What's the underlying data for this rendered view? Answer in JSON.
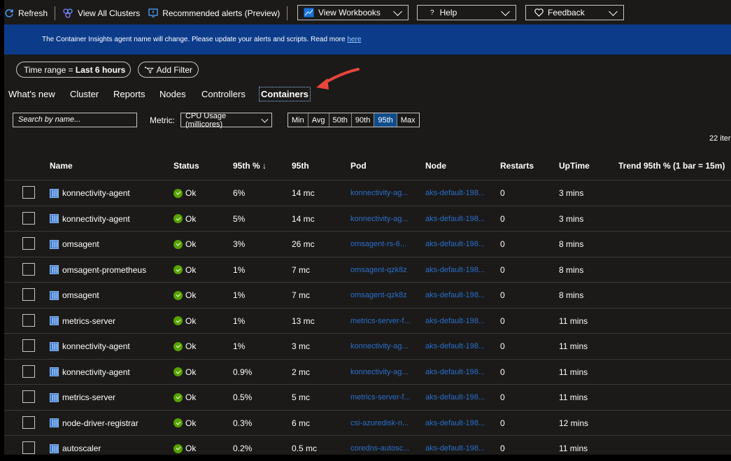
{
  "toolbar": {
    "refresh": "Refresh",
    "view_all_clusters": "View All Clusters",
    "recommended_alerts": "Recommended alerts (Preview)",
    "view_workbooks": "View Workbooks",
    "help": "Help",
    "feedback": "Feedback"
  },
  "banner": {
    "text": "The Container Insights agent name will change. Please update your alerts and scripts. Read more ",
    "link": "here"
  },
  "filters": {
    "time_range_prefix": "Time range = ",
    "time_range_value": "Last 6 hours",
    "add_filter": "Add Filter"
  },
  "tabs": [
    "What's new",
    "Cluster",
    "Reports",
    "Nodes",
    "Controllers",
    "Containers"
  ],
  "active_tab": "Containers",
  "search": {
    "placeholder": "Search by name..."
  },
  "metric": {
    "label": "Metric:",
    "value": "CPU Usage (millicores)"
  },
  "percentiles": [
    "Min",
    "Avg",
    "50th",
    "90th",
    "95th",
    "Max"
  ],
  "selected_percentile": "95th",
  "item_count": "22 iter",
  "table": {
    "headers": [
      "Name",
      "Status",
      "95th % ↓",
      "95th",
      "Pod",
      "Node",
      "Restarts",
      "UpTime",
      "Trend 95th % (1 bar = 15m)"
    ],
    "rows": [
      {
        "name": "konnectivity-agent",
        "status": "Ok",
        "pct": "6%",
        "val": "14 mc",
        "pod": "konnectivity-ag...",
        "node": "aks-default-198...",
        "restarts": "0",
        "uptime": "3 mins"
      },
      {
        "name": "konnectivity-agent",
        "status": "Ok",
        "pct": "5%",
        "val": "14 mc",
        "pod": "konnectivity-ag...",
        "node": "aks-default-198...",
        "restarts": "0",
        "uptime": "3 mins"
      },
      {
        "name": "omsagent",
        "status": "Ok",
        "pct": "3%",
        "val": "26 mc",
        "pod": "omsagent-rs-6...",
        "node": "aks-default-198...",
        "restarts": "0",
        "uptime": "8 mins"
      },
      {
        "name": "omsagent-prometheus",
        "status": "Ok",
        "pct": "1%",
        "val": "7 mc",
        "pod": "omsagent-qzk8z",
        "node": "aks-default-198...",
        "restarts": "0",
        "uptime": "8 mins"
      },
      {
        "name": "omsagent",
        "status": "Ok",
        "pct": "1%",
        "val": "7 mc",
        "pod": "omsagent-qzk8z",
        "node": "aks-default-198...",
        "restarts": "0",
        "uptime": "8 mins"
      },
      {
        "name": "metrics-server",
        "status": "Ok",
        "pct": "1%",
        "val": "13 mc",
        "pod": "metrics-server-f...",
        "node": "aks-default-198...",
        "restarts": "0",
        "uptime": "11 mins"
      },
      {
        "name": "konnectivity-agent",
        "status": "Ok",
        "pct": "1%",
        "val": "3 mc",
        "pod": "konnectivity-ag...",
        "node": "aks-default-198...",
        "restarts": "0",
        "uptime": "11 mins"
      },
      {
        "name": "konnectivity-agent",
        "status": "Ok",
        "pct": "0.9%",
        "val": "2 mc",
        "pod": "konnectivity-ag...",
        "node": "aks-default-198...",
        "restarts": "0",
        "uptime": "11 mins"
      },
      {
        "name": "metrics-server",
        "status": "Ok",
        "pct": "0.5%",
        "val": "5 mc",
        "pod": "metrics-server-f...",
        "node": "aks-default-198...",
        "restarts": "0",
        "uptime": "11 mins"
      },
      {
        "name": "node-driver-registrar",
        "status": "Ok",
        "pct": "0.3%",
        "val": "6 mc",
        "pod": "csi-azuredisk-n...",
        "node": "aks-default-198...",
        "restarts": "0",
        "uptime": "12 mins"
      },
      {
        "name": "autoscaler",
        "status": "Ok",
        "pct": "0.2%",
        "val": "0.5 mc",
        "pod": "coredns-autosc...",
        "node": "aks-default-198...",
        "restarts": "0",
        "uptime": "11 mins"
      }
    ]
  },
  "colors": {
    "banner": "#0c3b8a",
    "link": "#2a6fcb",
    "ok": "#57a300",
    "annotation_arrow": "#e8453c"
  }
}
